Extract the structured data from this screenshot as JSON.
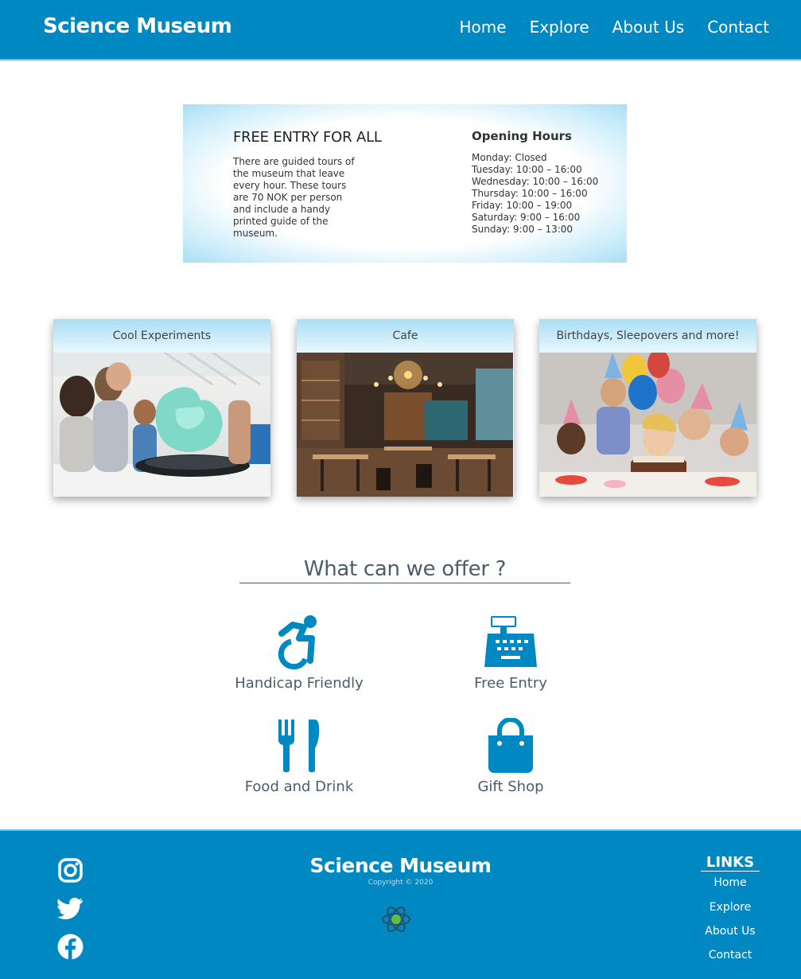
{
  "header": {
    "brand": "Science Museum",
    "nav": [
      "Home",
      "Explore",
      "About Us",
      "Contact"
    ]
  },
  "info": {
    "title": "FREE ENTRY FOR ALL",
    "description": "There are guided tours of the museum that leave every hour. These tours are 70 NOK per person and include a handy printed guide of the museum.",
    "hours_title": "Opening Hours",
    "hours": [
      "Monday: Closed",
      "Tuesday: 10:00 – 16:00",
      "Wednesday: 10:00 – 16:00",
      "Thursday: 10:00 – 16:00",
      "Friday: 10:00 – 19:00",
      "Saturday: 9:00 – 16:00",
      "Sunday: 9:00 – 13:00"
    ]
  },
  "cards": [
    "Cool Experiments",
    "Cafe",
    "Birthdays, Sleepovers and more!"
  ],
  "offer": {
    "title": "What can we offer ?",
    "features": [
      "Handicap Friendly",
      "Free Entry",
      "Food and Drink",
      "Gift Shop"
    ]
  },
  "footer": {
    "brand": "Science Museum",
    "copyright": "Copyright © 2020",
    "links_title": "LINKS",
    "links": [
      "Home",
      "Explore",
      "About Us",
      "Contact"
    ]
  },
  "colors": {
    "primary": "#0088c2",
    "accent_light": "#a9def5",
    "heading_gray": "#4a5d6a"
  },
  "icons": [
    "accessibility-icon",
    "cash-register-icon",
    "utensils-icon",
    "shopping-bag-icon",
    "instagram-icon",
    "twitter-icon",
    "facebook-icon",
    "atom-logo-icon"
  ]
}
